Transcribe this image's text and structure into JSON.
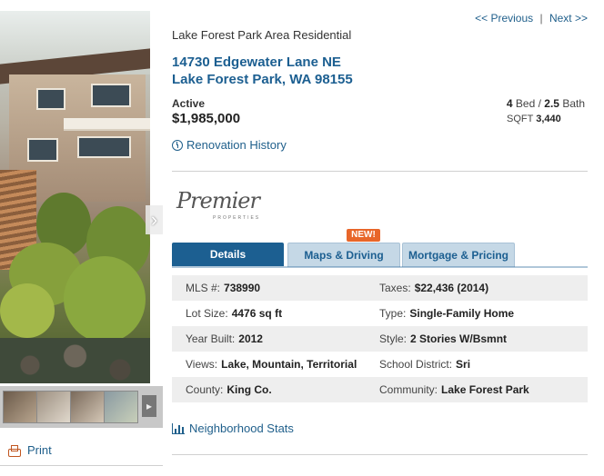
{
  "pager": {
    "previous_label": "<< Previous",
    "separator": "|",
    "next_label": "Next >>"
  },
  "listing": {
    "area": "Lake Forest Park Area Residential",
    "address_line1": "14730 Edgewater Lane NE",
    "address_line2": "Lake Forest Park, WA 98155",
    "status": "Active",
    "price": "$1,985,000",
    "beds": "4",
    "beds_label": "Bed /",
    "baths": "2.5",
    "baths_label": "Bath",
    "sqft_label": "SQFT",
    "sqft": "3,440",
    "renovation_link": "Renovation History"
  },
  "brand": {
    "logo_script": "Premier",
    "logo_sub": "PROPERTIES"
  },
  "tabs": {
    "new_badge": "NEW!",
    "details": "Details",
    "maps": "Maps & Driving",
    "mortgage": "Mortgage & Pricing"
  },
  "details": [
    {
      "l_key": "MLS #:",
      "l_val": "738990",
      "r_key": "Taxes:",
      "r_val": "$22,436 (2014)"
    },
    {
      "l_key": "Lot Size:",
      "l_val": "4476 sq ft",
      "r_key": "Type:",
      "r_val": "Single-Family Home"
    },
    {
      "l_key": "Year Built:",
      "l_val": "2012",
      "r_key": "Style:",
      "r_val": "2 Stories W/Bsmnt"
    },
    {
      "l_key": "Views:",
      "l_val": "Lake, Mountain, Territorial",
      "r_key": "School District:",
      "r_val": "Sri"
    },
    {
      "l_key": "County:",
      "l_val": "King Co.",
      "r_key": "Community:",
      "r_val": "Lake Forest Park"
    }
  ],
  "neighborhood_link": "Neighborhood Stats",
  "print_label": "Print",
  "icons": {
    "next_photo": "chevron-right-icon",
    "renovation": "clock-icon",
    "neighborhood": "bar-chart-icon",
    "print": "printer-icon"
  }
}
